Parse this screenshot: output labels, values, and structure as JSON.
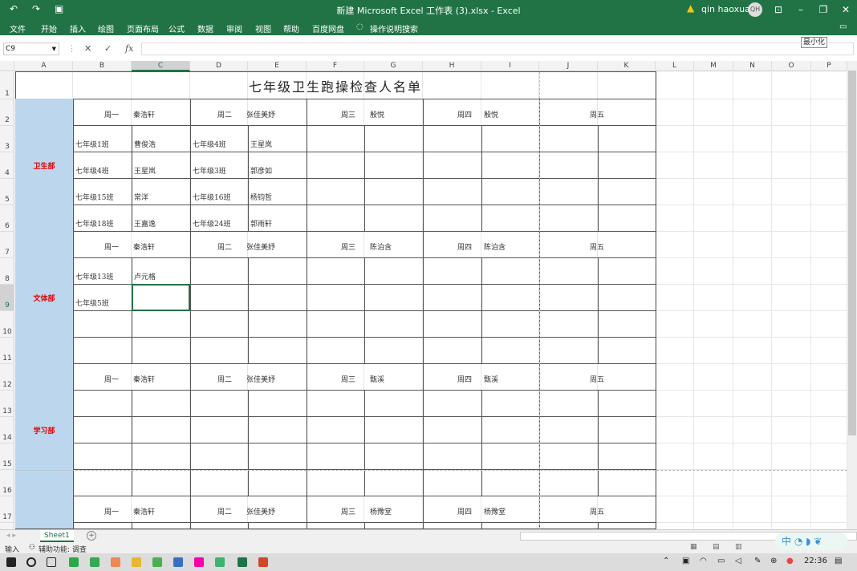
{
  "window": {
    "title": "新建 Microsoft Excel 工作表 (3).xlsx  -  Excel",
    "user": "qin haoxuan",
    "avatar": "QH",
    "tooltip": "最小化"
  },
  "menu": [
    "文件",
    "开始",
    "插入",
    "绘图",
    "页面布局",
    "公式",
    "数据",
    "审阅",
    "视图",
    "帮助",
    "百度网盘",
    "操作说明搜索"
  ],
  "namebox": "C9",
  "columns": [
    "A",
    "B",
    "C",
    "D",
    "E",
    "F",
    "G",
    "H",
    "I",
    "J",
    "K",
    "L",
    "M",
    "N",
    "O",
    "P"
  ],
  "rows": [
    "1",
    "2",
    "3",
    "4",
    "5",
    "6",
    "7",
    "8",
    "9",
    "10",
    "11",
    "12",
    "13",
    "14",
    "15",
    "16",
    "17"
  ],
  "sheet": {
    "title": "七年级卫生跑操检查人名单",
    "sections": [
      {
        "label": "卫生部",
        "head": [
          "周一",
          "秦浩轩",
          "周二",
          "张佳美妤",
          "周三",
          "殷悦",
          "周四",
          "殷悦",
          "周五"
        ],
        "rows": [
          [
            "七年级1班",
            "曹俊浩",
            "七年级4班",
            "王星岚"
          ],
          [
            "七年级4班",
            "王星岚",
            "七年级3班",
            "郭彦如"
          ],
          [
            "七年级15班",
            "常洋",
            "七年级16班",
            "杨钧哲"
          ],
          [
            "七年级18班",
            "王嘉逸",
            "七年级24班",
            "郭雨轩"
          ]
        ]
      },
      {
        "label": "文体部",
        "head": [
          "周一",
          "秦浩轩",
          "周二",
          "张佳美妤",
          "周三",
          "陈泊含",
          "周四",
          "陈泊含",
          "周五"
        ],
        "rows": [
          [
            "七年级13班",
            "卢元格",
            "",
            ""
          ],
          [
            "七年级5班",
            "",
            "",
            ""
          ],
          [
            "",
            "",
            "",
            ""
          ],
          [
            "",
            "",
            "",
            ""
          ]
        ]
      },
      {
        "label": "学习部",
        "head": [
          "周一",
          "秦浩轩",
          "周二",
          "张佳美妤",
          "周三",
          "甄溪",
          "周四",
          "甄溪",
          "周五"
        ],
        "rows": [
          [
            "",
            "",
            "",
            ""
          ],
          [
            "",
            "",
            "",
            ""
          ],
          [
            "",
            "",
            "",
            ""
          ],
          [
            "",
            "",
            "",
            ""
          ]
        ]
      },
      {
        "label": "",
        "head": [
          "周一",
          "秦浩轩",
          "周二",
          "张佳美妤",
          "周三",
          "杨豫堂",
          "周四",
          "杨豫堂",
          "周五"
        ],
        "rows": []
      }
    ]
  },
  "tab": "Sheet1",
  "status": {
    "mode": "输入",
    "accessibility": "辅助功能: 调查"
  },
  "ime": "中",
  "clock": "22:36"
}
